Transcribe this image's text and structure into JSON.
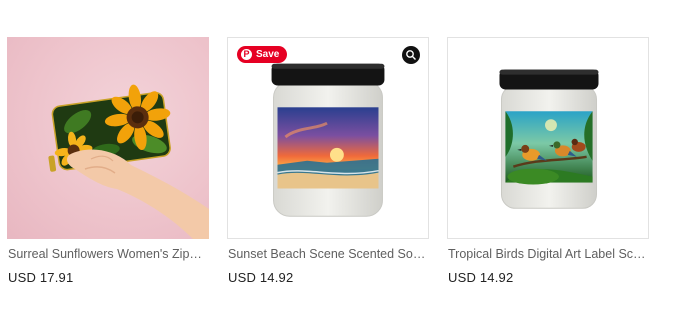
{
  "products": [
    {
      "title": "Surreal Sunflowers Women's Zipper Wallet",
      "price": "USD 17.91",
      "image_icon": "sunflower-wallet-image"
    },
    {
      "title": "Sunset Beach Scene Scented Soy Candle",
      "price": "USD 14.92",
      "image_icon": "sunset-candle-image",
      "save_label": "Save"
    },
    {
      "title": "Tropical Birds Digital Art Label Scented Candle",
      "price": "USD 14.92",
      "image_icon": "tropical-birds-candle-image"
    }
  ],
  "colors": {
    "pinterest_red": "#e60023",
    "title_gray": "#5f5f5f",
    "price_dark": "#222222"
  }
}
